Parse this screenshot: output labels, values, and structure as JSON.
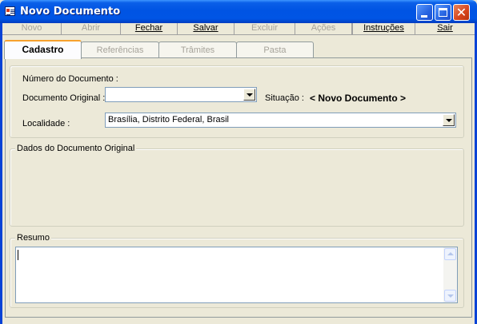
{
  "window": {
    "title": "Novo Documento",
    "close_symbol": "✕"
  },
  "menu": {
    "items": [
      {
        "label": "Novo",
        "enabled": false
      },
      {
        "label": "Abrir",
        "enabled": false
      },
      {
        "label": "Fechar",
        "enabled": true
      },
      {
        "label": "Salvar",
        "enabled": true
      },
      {
        "label": "Excluir",
        "enabled": false
      },
      {
        "label": "Ações",
        "enabled": false
      },
      {
        "label": "Instruções",
        "enabled": true
      },
      {
        "label": "Sair",
        "enabled": true
      }
    ]
  },
  "tabs": [
    {
      "label": "Cadastro",
      "active": true
    },
    {
      "label": "Referências",
      "active": false
    },
    {
      "label": "Trâmites",
      "active": false
    },
    {
      "label": "Pasta",
      "active": false
    }
  ],
  "cadastro": {
    "numero_label": "Número do Documento :",
    "doc_original_label": "Documento Original :",
    "doc_original_value": "",
    "situacao_label": "Situação :",
    "situacao_value": "< Novo Documento >",
    "localidade_label": "Localidade :",
    "localidade_value": "Brasília, Distrito Federal, Brasil"
  },
  "dados_group": {
    "label": "Dados do Documento Original"
  },
  "resumo_group": {
    "label": "Resumo",
    "value": ""
  },
  "colors": {
    "titlebar": "#0054e3",
    "face": "#ece9d8",
    "disabled_text": "#a6a39a",
    "active_tab_accent": "#f7a12d"
  }
}
